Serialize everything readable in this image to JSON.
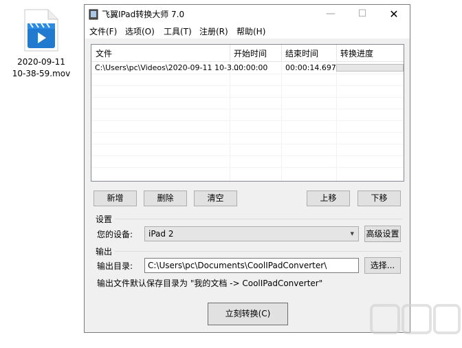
{
  "desktop": {
    "file_label_line1": "2020-09-11",
    "file_label_line2": "10-38-59.mov",
    "icon": "video-file-icon"
  },
  "window": {
    "title": "飞翼IPad转换大师 7.0",
    "controls": {
      "minimize": "—",
      "maximize": "☐",
      "close": "✕"
    }
  },
  "menu": [
    "文件(F)",
    "选项(O)",
    "工具(T)",
    "注册(R)",
    "帮助(H)"
  ],
  "table": {
    "columns": [
      "文件",
      "开始时间",
      "结束时间",
      "转换进度"
    ],
    "rows": [
      {
        "file": "C:\\Users\\pc\\Videos\\2020-09-11 10-3...",
        "start": "00:00:00",
        "end": "00:00:14.697",
        "progress": 0
      }
    ]
  },
  "buttons": {
    "add": "新增",
    "delete": "删除",
    "clear": "清空",
    "up": "上移",
    "down": "下移",
    "advanced": "高级设置",
    "browse": "选择...",
    "convert": "立刻转换(C)"
  },
  "settings": {
    "group_label": "设置",
    "device_label": "您的设备:",
    "device_value": "iPad 2"
  },
  "output": {
    "group_label": "输出",
    "dir_label": "输出目录:",
    "dir_value": "C:\\Users\\pc\\Documents\\CoolIPadConverter\\",
    "hint": "输出文件默认保存目录为 \"我的文档 -> CoolIPadConverter\""
  },
  "colors": {
    "accent": "#1b6ec2",
    "progress_fill": "#06b025"
  },
  "watermark": "下载吧"
}
